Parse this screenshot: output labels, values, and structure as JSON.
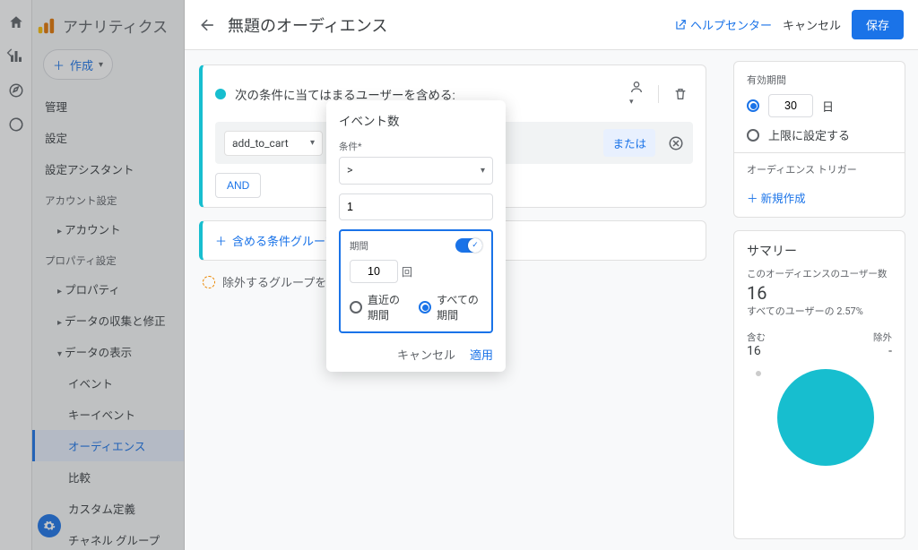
{
  "brand": "アナリティクス",
  "create_label": "作成",
  "nav": {
    "admin": "管理",
    "settings": "設定",
    "setup_assistant": "設定アシスタント",
    "account_section": "アカウント設定",
    "account": "アカウント",
    "property_section": "プロパティ設定",
    "property": "プロパティ",
    "data_collection": "データの収集と修正",
    "data_display": "データの表示",
    "events": "イベント",
    "key_events": "キーイベント",
    "audiences": "オーディエンス",
    "compare": "比較",
    "custom_def": "カスタム定義",
    "channel_groups": "チャネル グループ"
  },
  "page": {
    "title": "無題のオーディエンス",
    "help": "ヘルプセンター",
    "cancel": "キャンセル",
    "save": "保存"
  },
  "condition": {
    "head": "次の条件に当てはまるユーザーを含める:",
    "event": "add_to_cart",
    "or": "または",
    "and": "AND",
    "add_group": "含める条件グループを",
    "exclude_group": "除外するグループを追"
  },
  "popover": {
    "title": "イベント数",
    "cond_label": "条件*",
    "operator": ">",
    "value": "1",
    "period_label": "期間",
    "period_value": "10",
    "period_unit": "回",
    "recent": "直近の期間",
    "all": "すべての期間",
    "cancel": "キャンセル",
    "apply": "適用"
  },
  "duration": {
    "label": "有効期間",
    "value": "30",
    "unit": "日",
    "to_max": "上限に設定する"
  },
  "trigger": {
    "label": "オーディエンス トリガー",
    "new": "新規作成"
  },
  "summary": {
    "title": "サマリー",
    "users_label": "このオーディエンスのユーザー数",
    "users_value": "16",
    "pct": "すべてのユーザーの 2.57%",
    "include_label": "含む",
    "include_value": "16",
    "exclude_label": "除外",
    "exclude_value": "-"
  },
  "chart_data": {
    "type": "pie",
    "categories": [
      "含む",
      "除外"
    ],
    "values": [
      16,
      0
    ],
    "title": "サマリー"
  }
}
